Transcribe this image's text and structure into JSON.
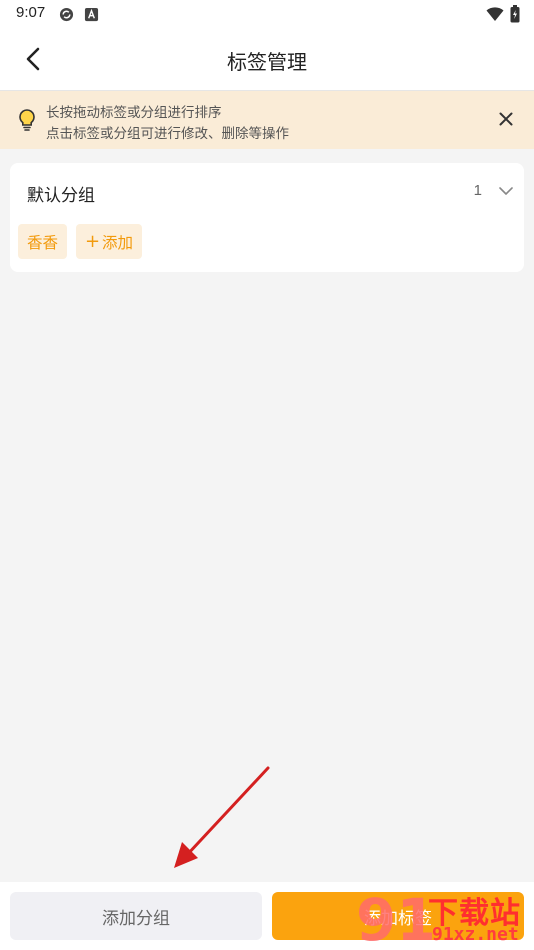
{
  "status_bar": {
    "time": "9:07",
    "icons": [
      "sync-icon",
      "app-a-icon",
      "wifi-icon",
      "battery-icon"
    ]
  },
  "header": {
    "title": "标签管理",
    "back_icon": "chevron-left-icon"
  },
  "tip": {
    "icon": "lightbulb-icon",
    "line1": "长按拖动标签或分组进行排序",
    "line2": "点击标签或分组可进行修改、删除等操作",
    "close_icon": "close-icon"
  },
  "group": {
    "name": "默认分组",
    "count": "1",
    "chevron_icon": "chevron-down-icon",
    "tags": [
      {
        "label": "香香"
      }
    ],
    "add_chip": {
      "plus": "+",
      "label": "添加"
    }
  },
  "bottom": {
    "add_group_label": "添加分组",
    "add_tag_label": "添加标签"
  },
  "watermark": {
    "logo_text": "91",
    "brand": "下载站",
    "url": "91xz.net"
  },
  "colors": {
    "accent": "#fba30e",
    "tip_background": "#faecd7",
    "chip_background": "#fcefdc",
    "chip_text": "#f29a0c",
    "annotation_arrow": "#d42020"
  }
}
